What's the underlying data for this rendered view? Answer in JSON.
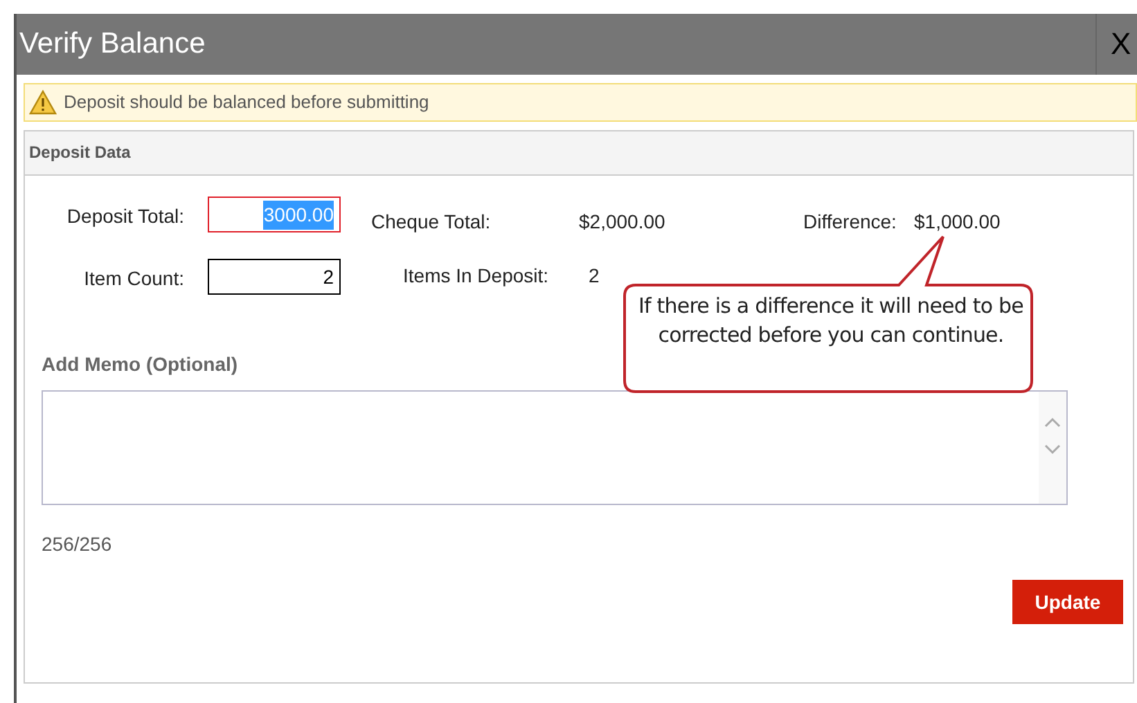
{
  "window": {
    "title": "Verify Balance",
    "close": "X"
  },
  "warning": {
    "text": "Deposit should be balanced before submitting"
  },
  "panel": {
    "title": "Deposit Data",
    "deposit_total": {
      "label": "Deposit Total:",
      "value": "3000.00",
      "invalid": true,
      "text_selected": true
    },
    "cheque_total": {
      "label": "Cheque Total:",
      "value": "$2,000.00"
    },
    "difference": {
      "label": "Difference:",
      "value": "$1,000.00"
    },
    "item_count": {
      "label": "Item Count:",
      "value": "2",
      "invalid": false,
      "text_selected": false
    },
    "items_in_deposit": {
      "label": "Items In Deposit:",
      "value": "2"
    },
    "memo": {
      "label": "Add Memo (Optional)",
      "counter": "256/256"
    },
    "button": "Update"
  },
  "callout": {
    "text": "If there is a difference it will need to be corrected before you can continue."
  }
}
